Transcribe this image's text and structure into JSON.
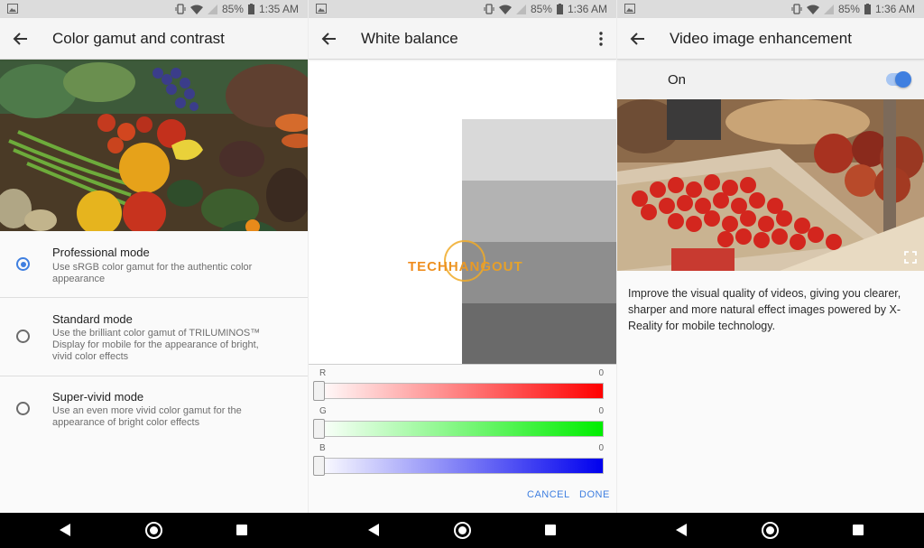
{
  "status_bar": {
    "battery": "85%",
    "times": [
      "1:35 AM",
      "1:36 AM",
      "1:36 AM"
    ]
  },
  "screens": [
    {
      "title": "Color gamut and contrast",
      "options": [
        {
          "title": "Professional mode",
          "description": "Use sRGB color gamut for the authentic color appearance",
          "selected": true
        },
        {
          "title": "Standard mode",
          "description": "Use the brilliant color gamut of TRILUMINOS™ Display for mobile for the appearance of bright, vivid color effects",
          "selected": false
        },
        {
          "title": "Super-vivid mode",
          "description": "Use an even more vivid color gamut for the appearance of bright color effects",
          "selected": false
        }
      ]
    },
    {
      "title": "White balance",
      "watermark": "TECHHANGOUT",
      "sliders": [
        {
          "label": "R",
          "value": "0",
          "color": "#ff0000"
        },
        {
          "label": "G",
          "value": "0",
          "color": "#00ee00"
        },
        {
          "label": "B",
          "value": "0",
          "color": "#0000ee"
        }
      ],
      "cancel_label": "CANCEL",
      "done_label": "DONE"
    },
    {
      "title": "Video image enhancement",
      "toggle_label": "On",
      "toggle_state": true,
      "description": "Improve the visual quality of videos, giving you clearer, sharper and more natural effect images powered by X-Reality for mobile technology."
    }
  ],
  "colors": {
    "accent": "#3f7fe0",
    "navbar": "#000000",
    "statusbar": "#dcdcdc"
  },
  "icons": [
    "back-arrow-icon",
    "more-vert-icon",
    "fullscreen-icon",
    "nav-back-icon",
    "nav-home-icon",
    "nav-recents-icon",
    "vibrate-icon",
    "wifi-icon",
    "signal-icon",
    "battery-icon",
    "image-notification-icon"
  ]
}
